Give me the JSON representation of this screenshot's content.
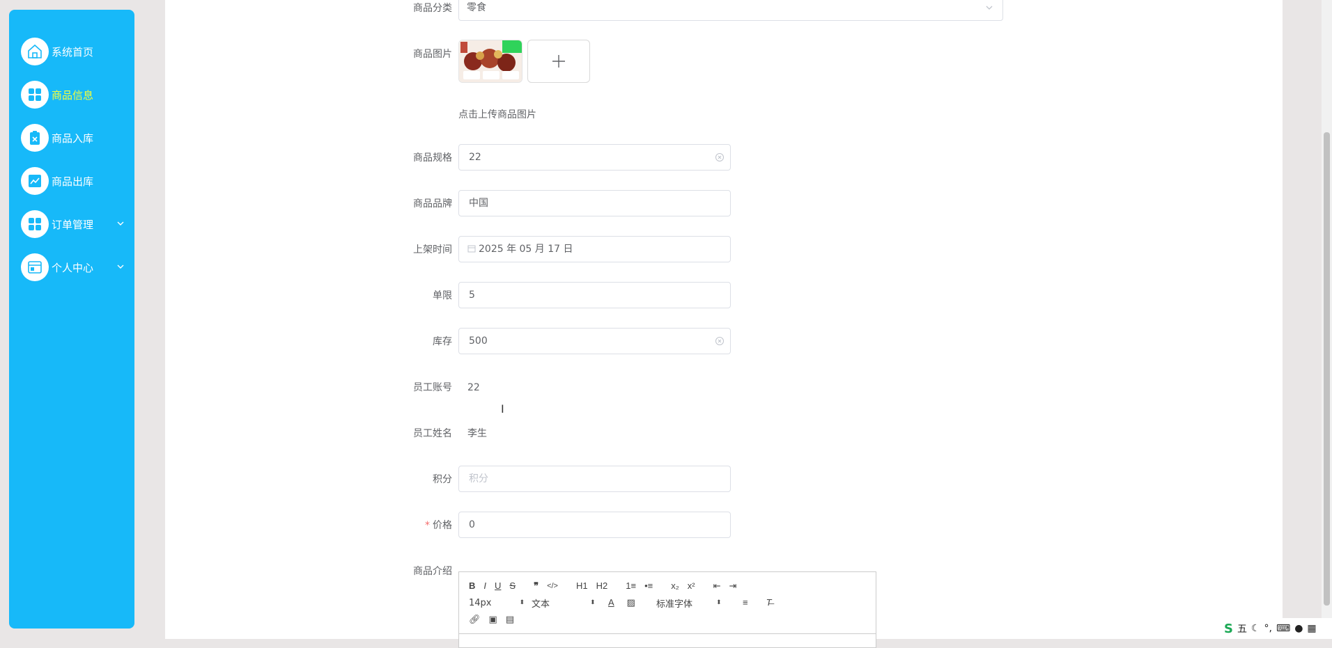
{
  "sidebar": {
    "items": [
      {
        "label": "系统首页",
        "icon": "home-icon",
        "active": false,
        "expandable": false
      },
      {
        "label": "商品信息",
        "icon": "grid-icon",
        "active": true,
        "expandable": false
      },
      {
        "label": "商品入库",
        "icon": "clipboard-icon",
        "active": false,
        "expandable": false
      },
      {
        "label": "商品出库",
        "icon": "chart-icon",
        "active": false,
        "expandable": false
      },
      {
        "label": "订单管理",
        "icon": "grid-icon",
        "active": false,
        "expandable": true
      },
      {
        "label": "个人中心",
        "icon": "card-icon",
        "active": false,
        "expandable": true
      }
    ]
  },
  "colors": {
    "sidebar": "#17b9f9",
    "active_text": "#f4ff3c",
    "required": "#f56c6c"
  },
  "form": {
    "category": {
      "label": "商品分类",
      "value": "零食"
    },
    "image": {
      "label": "商品图片",
      "hint": "点击上传商品图片"
    },
    "spec": {
      "label": "商品规格",
      "value": "22"
    },
    "brand": {
      "label": "商品品牌",
      "value": "中国"
    },
    "shelf_time": {
      "label": "上架时间",
      "value": "2025 年 05 月 17 日"
    },
    "limit": {
      "label": "单限",
      "value": "5"
    },
    "stock": {
      "label": "库存",
      "value": "500"
    },
    "staff_account": {
      "label": "员工账号",
      "value": "22"
    },
    "staff_name": {
      "label": "员工姓名",
      "value": "李生"
    },
    "points": {
      "label": "积分",
      "placeholder": "积分",
      "value": ""
    },
    "price": {
      "label": "价格",
      "required_mark": "*",
      "value": "0"
    },
    "intro": {
      "label": "商品介绍"
    }
  },
  "editor": {
    "row1": [
      "B",
      "I",
      "U",
      "S",
      "❞",
      "</>",
      "H1",
      "H2",
      "1≡",
      "•≡",
      "x₂",
      "x²",
      "⇤",
      "⇥"
    ],
    "font_size": "14px",
    "header_select": "文本",
    "font_family": "标准字体"
  },
  "ime": {
    "label": "五"
  }
}
